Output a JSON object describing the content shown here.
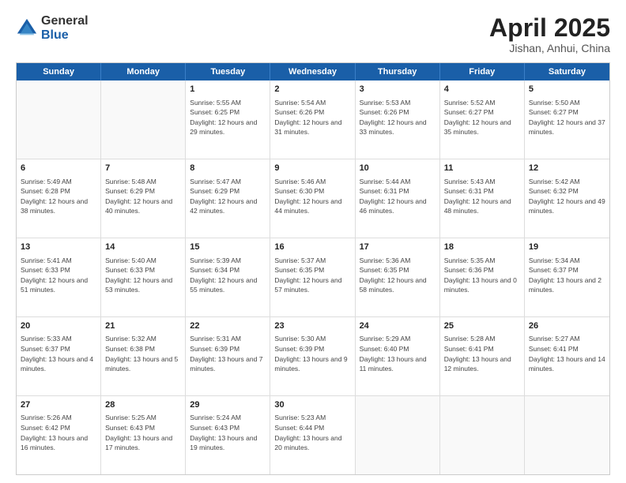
{
  "logo": {
    "general": "General",
    "blue": "Blue"
  },
  "title": "April 2025",
  "location": "Jishan, Anhui, China",
  "days": [
    "Sunday",
    "Monday",
    "Tuesday",
    "Wednesday",
    "Thursday",
    "Friday",
    "Saturday"
  ],
  "weeks": [
    [
      {
        "day": "",
        "sunrise": "",
        "sunset": "",
        "daylight": ""
      },
      {
        "day": "",
        "sunrise": "",
        "sunset": "",
        "daylight": ""
      },
      {
        "day": "1",
        "sunrise": "Sunrise: 5:55 AM",
        "sunset": "Sunset: 6:25 PM",
        "daylight": "Daylight: 12 hours and 29 minutes."
      },
      {
        "day": "2",
        "sunrise": "Sunrise: 5:54 AM",
        "sunset": "Sunset: 6:26 PM",
        "daylight": "Daylight: 12 hours and 31 minutes."
      },
      {
        "day": "3",
        "sunrise": "Sunrise: 5:53 AM",
        "sunset": "Sunset: 6:26 PM",
        "daylight": "Daylight: 12 hours and 33 minutes."
      },
      {
        "day": "4",
        "sunrise": "Sunrise: 5:52 AM",
        "sunset": "Sunset: 6:27 PM",
        "daylight": "Daylight: 12 hours and 35 minutes."
      },
      {
        "day": "5",
        "sunrise": "Sunrise: 5:50 AM",
        "sunset": "Sunset: 6:27 PM",
        "daylight": "Daylight: 12 hours and 37 minutes."
      }
    ],
    [
      {
        "day": "6",
        "sunrise": "Sunrise: 5:49 AM",
        "sunset": "Sunset: 6:28 PM",
        "daylight": "Daylight: 12 hours and 38 minutes."
      },
      {
        "day": "7",
        "sunrise": "Sunrise: 5:48 AM",
        "sunset": "Sunset: 6:29 PM",
        "daylight": "Daylight: 12 hours and 40 minutes."
      },
      {
        "day": "8",
        "sunrise": "Sunrise: 5:47 AM",
        "sunset": "Sunset: 6:29 PM",
        "daylight": "Daylight: 12 hours and 42 minutes."
      },
      {
        "day": "9",
        "sunrise": "Sunrise: 5:46 AM",
        "sunset": "Sunset: 6:30 PM",
        "daylight": "Daylight: 12 hours and 44 minutes."
      },
      {
        "day": "10",
        "sunrise": "Sunrise: 5:44 AM",
        "sunset": "Sunset: 6:31 PM",
        "daylight": "Daylight: 12 hours and 46 minutes."
      },
      {
        "day": "11",
        "sunrise": "Sunrise: 5:43 AM",
        "sunset": "Sunset: 6:31 PM",
        "daylight": "Daylight: 12 hours and 48 minutes."
      },
      {
        "day": "12",
        "sunrise": "Sunrise: 5:42 AM",
        "sunset": "Sunset: 6:32 PM",
        "daylight": "Daylight: 12 hours and 49 minutes."
      }
    ],
    [
      {
        "day": "13",
        "sunrise": "Sunrise: 5:41 AM",
        "sunset": "Sunset: 6:33 PM",
        "daylight": "Daylight: 12 hours and 51 minutes."
      },
      {
        "day": "14",
        "sunrise": "Sunrise: 5:40 AM",
        "sunset": "Sunset: 6:33 PM",
        "daylight": "Daylight: 12 hours and 53 minutes."
      },
      {
        "day": "15",
        "sunrise": "Sunrise: 5:39 AM",
        "sunset": "Sunset: 6:34 PM",
        "daylight": "Daylight: 12 hours and 55 minutes."
      },
      {
        "day": "16",
        "sunrise": "Sunrise: 5:37 AM",
        "sunset": "Sunset: 6:35 PM",
        "daylight": "Daylight: 12 hours and 57 minutes."
      },
      {
        "day": "17",
        "sunrise": "Sunrise: 5:36 AM",
        "sunset": "Sunset: 6:35 PM",
        "daylight": "Daylight: 12 hours and 58 minutes."
      },
      {
        "day": "18",
        "sunrise": "Sunrise: 5:35 AM",
        "sunset": "Sunset: 6:36 PM",
        "daylight": "Daylight: 13 hours and 0 minutes."
      },
      {
        "day": "19",
        "sunrise": "Sunrise: 5:34 AM",
        "sunset": "Sunset: 6:37 PM",
        "daylight": "Daylight: 13 hours and 2 minutes."
      }
    ],
    [
      {
        "day": "20",
        "sunrise": "Sunrise: 5:33 AM",
        "sunset": "Sunset: 6:37 PM",
        "daylight": "Daylight: 13 hours and 4 minutes."
      },
      {
        "day": "21",
        "sunrise": "Sunrise: 5:32 AM",
        "sunset": "Sunset: 6:38 PM",
        "daylight": "Daylight: 13 hours and 5 minutes."
      },
      {
        "day": "22",
        "sunrise": "Sunrise: 5:31 AM",
        "sunset": "Sunset: 6:39 PM",
        "daylight": "Daylight: 13 hours and 7 minutes."
      },
      {
        "day": "23",
        "sunrise": "Sunrise: 5:30 AM",
        "sunset": "Sunset: 6:39 PM",
        "daylight": "Daylight: 13 hours and 9 minutes."
      },
      {
        "day": "24",
        "sunrise": "Sunrise: 5:29 AM",
        "sunset": "Sunset: 6:40 PM",
        "daylight": "Daylight: 13 hours and 11 minutes."
      },
      {
        "day": "25",
        "sunrise": "Sunrise: 5:28 AM",
        "sunset": "Sunset: 6:41 PM",
        "daylight": "Daylight: 13 hours and 12 minutes."
      },
      {
        "day": "26",
        "sunrise": "Sunrise: 5:27 AM",
        "sunset": "Sunset: 6:41 PM",
        "daylight": "Daylight: 13 hours and 14 minutes."
      }
    ],
    [
      {
        "day": "27",
        "sunrise": "Sunrise: 5:26 AM",
        "sunset": "Sunset: 6:42 PM",
        "daylight": "Daylight: 13 hours and 16 minutes."
      },
      {
        "day": "28",
        "sunrise": "Sunrise: 5:25 AM",
        "sunset": "Sunset: 6:43 PM",
        "daylight": "Daylight: 13 hours and 17 minutes."
      },
      {
        "day": "29",
        "sunrise": "Sunrise: 5:24 AM",
        "sunset": "Sunset: 6:43 PM",
        "daylight": "Daylight: 13 hours and 19 minutes."
      },
      {
        "day": "30",
        "sunrise": "Sunrise: 5:23 AM",
        "sunset": "Sunset: 6:44 PM",
        "daylight": "Daylight: 13 hours and 20 minutes."
      },
      {
        "day": "",
        "sunrise": "",
        "sunset": "",
        "daylight": ""
      },
      {
        "day": "",
        "sunrise": "",
        "sunset": "",
        "daylight": ""
      },
      {
        "day": "",
        "sunrise": "",
        "sunset": "",
        "daylight": ""
      }
    ]
  ]
}
